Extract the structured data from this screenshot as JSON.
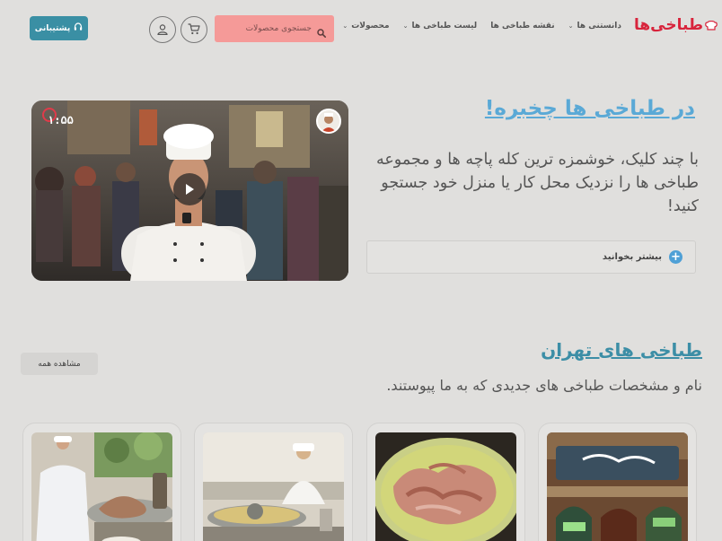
{
  "header": {
    "logo_text": "طباخی‌ها",
    "nav": [
      {
        "label": "محصولات",
        "has_dropdown": true
      },
      {
        "label": "لیست طباخی ها",
        "has_dropdown": true
      },
      {
        "label": "نقشه طباخی ها",
        "has_dropdown": false
      },
      {
        "label": "دانستنی ها",
        "has_dropdown": true
      }
    ],
    "search_placeholder": "جستجوی محصولات",
    "support_label": "پشتیبانی"
  },
  "hero": {
    "title": "در طباخی ها چخبره!",
    "description": "با چند کلیک، خوشمزه ترین کله پاچه ها و مجموعه طباخی ها را نزدیک محل کار یا منزل خود جستجو کنید!",
    "read_more_label": "بیشتر بخوانید",
    "video_time": "۱:۵۵"
  },
  "section": {
    "title": "طباخی های تهران",
    "description": "نام و مشخصات طباخی های جدیدی که به ما پیوستند.",
    "view_all_label": "مشاهده همه"
  },
  "colors": {
    "background": "#e0dfdd",
    "logo_red": "#d8243c",
    "search_bg": "#f59a98",
    "support_bg": "#3a8fa4",
    "hero_title": "#5aa9d6",
    "section_title": "#3c8ea6"
  },
  "icons": {
    "search": "search-icon",
    "cart": "cart-icon",
    "user": "user-icon",
    "headset": "headset-icon",
    "play": "play-icon",
    "plus": "plus-circle-icon"
  }
}
